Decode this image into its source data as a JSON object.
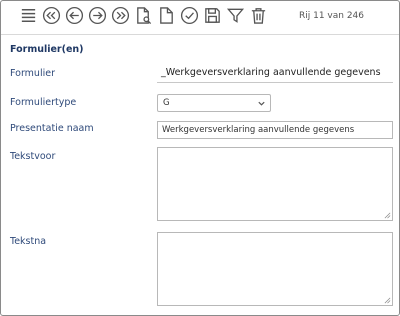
{
  "toolbar": {
    "icons": [
      "list-icon",
      "first-record-icon",
      "previous-record-icon",
      "next-record-icon",
      "last-record-icon",
      "search-document-icon",
      "new-document-icon",
      "validate-icon",
      "save-icon",
      "filter-icon",
      "delete-icon"
    ],
    "row_info": "Rij 11 van 246"
  },
  "form": {
    "section_title": "Formulier(en)",
    "formulier_label": "Formulier",
    "formulier_value": "_Werkgeversverklaring aanvullende gegevens",
    "formuliertype_label": "Formuliertype",
    "formuliertype_value": "G",
    "presentatie_label": "Presentatie naam",
    "presentatie_value": "Werkgeversverklaring aanvullende gegevens",
    "tekstvoor_label": "Tekstvoor",
    "tekstna_label": "Tekstna"
  },
  "colors": {
    "label": "#2f4a7a",
    "title": "#1f3864",
    "icon": "#555555"
  }
}
